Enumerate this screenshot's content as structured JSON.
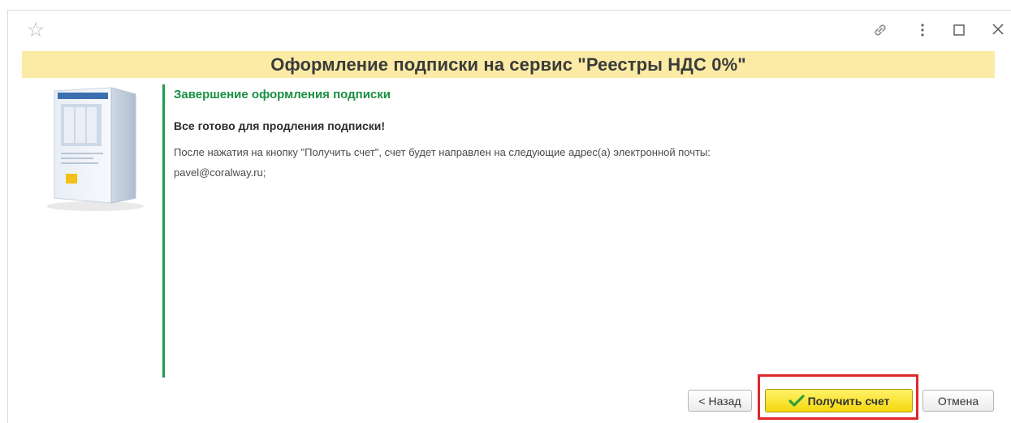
{
  "window": {
    "favorite_icon": "star-icon",
    "link_icon": "link-icon",
    "more_icon": "more-vertical-icon",
    "maximize_icon": "maximize-icon",
    "close_icon": "close-icon"
  },
  "header": {
    "title": "Оформление подписки на сервис \"Реестры НДС 0%\"",
    "background": "#fbeba4"
  },
  "main": {
    "product_image": "product-box-image",
    "step_title": "Завершение оформления подписки",
    "ready_message": "Все готово для продления подписки!",
    "info_message": "После нажатия на кнопку \"Получить счет\", счет будет направлен на следующие адрес(а) электронной почты:",
    "email": "pavel@coralway.ru;",
    "accent_color": "#1c9c4c"
  },
  "footer": {
    "back_label": "< Назад",
    "get_invoice_label": "Получить счет",
    "cancel_label": "Отмена",
    "highlight_color": "#e0272b"
  }
}
